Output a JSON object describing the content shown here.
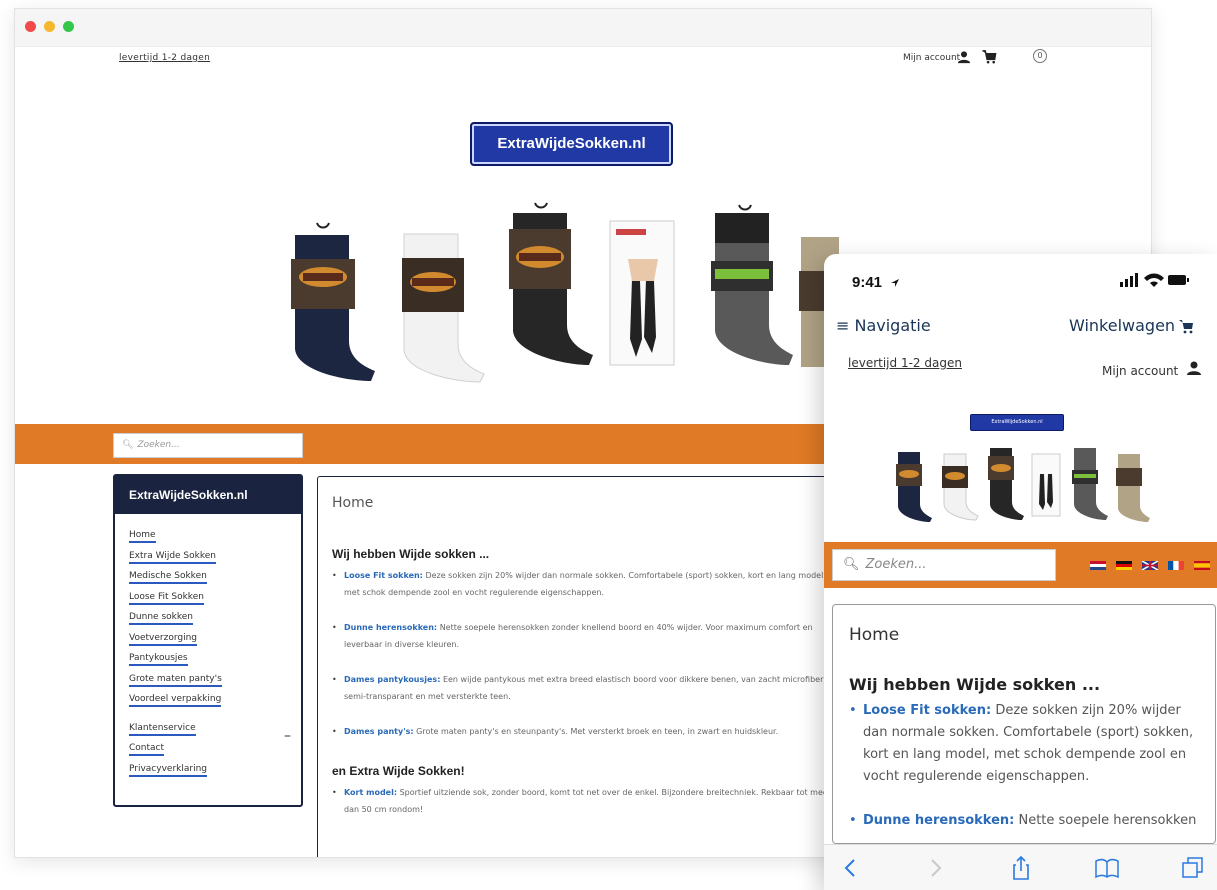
{
  "desktop": {
    "delivery_link": "levertijd 1-2 dagen",
    "account_label": "Mijn account",
    "cart_count": "0",
    "logo_text": "ExtraWijdeSokken.nl",
    "search_placeholder": "Zoeken...",
    "sidebar": {
      "title": "ExtraWijdeSokken.nl",
      "items": [
        {
          "label": "Home"
        },
        {
          "label": "Extra Wijde Sokken"
        },
        {
          "label": "Medische Sokken"
        },
        {
          "label": "Loose Fit Sokken"
        },
        {
          "label": "Dunne sokken"
        },
        {
          "label": "Voetverzorging"
        },
        {
          "label": "Pantykousjes"
        },
        {
          "label": "Grote maten panty's"
        },
        {
          "label": "Voordeel verpakking"
        }
      ],
      "service_items": [
        {
          "label": "Klantenservice"
        },
        {
          "label": "Contact"
        },
        {
          "label": "Privacyverklaring"
        }
      ],
      "collapse_symbol": "–"
    },
    "content": {
      "page_title": "Home",
      "heading1": "Wij hebben Wijde sokken ...",
      "bullets1": [
        {
          "title": "Loose Fit sokken:",
          "text": "Deze sokken zijn 20% wijder dan normale sokken. Comfortabele (sport) sokken, kort en lang model, met schok dempende zool en vocht regulerende eigenschappen."
        },
        {
          "title": "Dunne herensokken:",
          "text": "Nette soepele herensokken zonder knellend boord en 40% wijder. Voor maximum comfort en leverbaar in diverse kleuren."
        },
        {
          "title": "Dames pantykousjes:",
          "text": "Een wijde pantykous met extra breed elastisch boord voor dikkere benen, van zacht microfiber, semi-transparant en met versterkte teen."
        },
        {
          "title": "Dames panty's:",
          "text": "Grote maten panty's en steunpanty's. Met versterkt broek en teen, in zwart en huidskleur."
        }
      ],
      "heading2": "en Extra Wijde Sokken!",
      "bullets2": [
        {
          "title": "Kort model:",
          "text": "Sportief uitziende sok, zonder boord, komt tot net over de enkel. Bijzondere breitechniek. Rekbaar tot meer dan 50 cm rondom!"
        }
      ]
    }
  },
  "phone": {
    "time": "9:41",
    "nav_label": "≡ Navigatie",
    "cart_label": "Winkelwagen",
    "delivery_link": "levertijd 1-2 dagen",
    "account_label": "Mijn account",
    "logo_text": "ExtraWijdeSokken.nl",
    "search_placeholder": "Zoeken...",
    "content": {
      "page_title": "Home",
      "heading": "Wij hebben Wijde sokken ...",
      "bullets": [
        {
          "title": "Loose Fit sokken:",
          "text": "Deze sokken zijn 20% wijder dan normale sokken. Comfortabele (sport) sokken, kort en lang model, met schok dempende zool en vocht regulerende eigenschappen."
        },
        {
          "title": "Dunne herensokken:",
          "text": "Nette soepele herensokken"
        }
      ]
    }
  },
  "colors": {
    "accent_orange": "#e07a26",
    "navy": "#1a2340",
    "logo_blue": "#2139a5",
    "link_blue": "#2a6ab8"
  }
}
